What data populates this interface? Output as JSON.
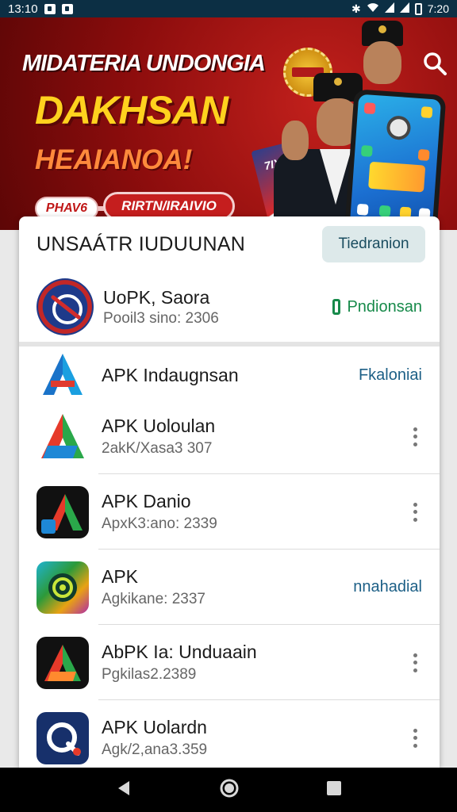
{
  "status_bar": {
    "time_left": "13:10",
    "time_right": "7:20",
    "icons": [
      "notification-icon",
      "notification-icon",
      "bluetooth-icon",
      "wifi-icon",
      "signal-icon",
      "signal-icon",
      "battery-icon"
    ]
  },
  "banner": {
    "title_line1": "MIDATERIA UNDONGIA",
    "title_line2": "DAKHSAN",
    "title_line3": "HEAIANOA!",
    "pill_small": "PHAV6",
    "pill_large": "RIRTN/IRAIVIO",
    "stripe_text": "7IX",
    "colors": {
      "background": "#8d0d0d",
      "headline": "#ffd21e",
      "subheadline": "#ff8a3c"
    }
  },
  "panel": {
    "title": "UNSAÁTR IUDUUNAN",
    "header_button": "Tiedranion"
  },
  "featured": {
    "name": "UoPK, Saora",
    "subtitle": "Pooil3 sino: 2306",
    "action": "Pndionsan",
    "action_color": "#178a4a"
  },
  "list": {
    "first": {
      "name": "APK Indaugnsan",
      "action": "Fkaloniai"
    },
    "rows": [
      {
        "name": "APK Uoloulan",
        "subtitle": "2akK/Xasa3 307",
        "icon": "app-icon-a"
      },
      {
        "name": "APK Danio",
        "subtitle": "ApxK3:ano: 2339",
        "icon": "app-icon-a-dark"
      },
      {
        "name": "APK",
        "subtitle": "Agkikane: 2337",
        "icon": "app-icon-camera",
        "action": "nnahadial"
      },
      {
        "name": "AbPK Ia: Unduaain",
        "subtitle": "Pgkilas2.2389",
        "icon": "app-icon-a-dark"
      },
      {
        "name": "APK Uolardn",
        "subtitle": "Agk/2,ana3.359",
        "icon": "app-icon-q"
      }
    ]
  },
  "nav": {
    "icons": [
      "back-icon",
      "home-icon",
      "recents-icon"
    ]
  }
}
